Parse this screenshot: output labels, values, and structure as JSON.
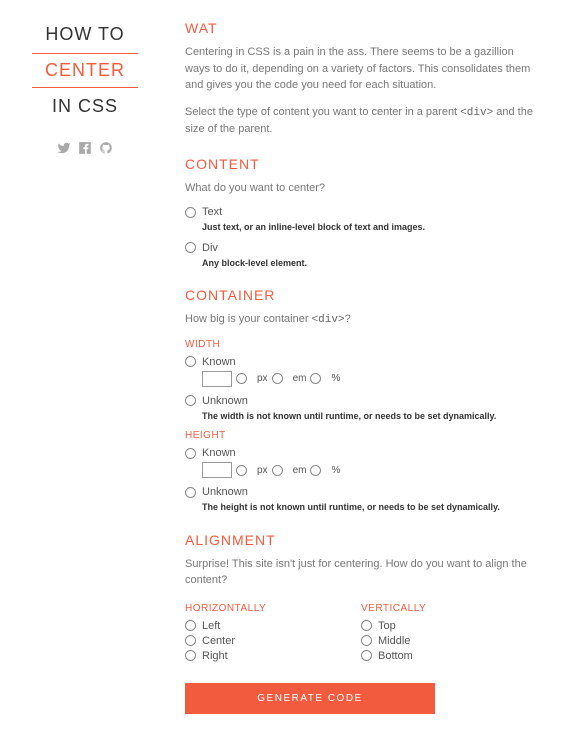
{
  "logo": {
    "line1": "HOW TO",
    "line2": "CENTER",
    "line3": "IN CSS"
  },
  "wat": {
    "heading": "WAT",
    "p1": "Centering in CSS is a pain in the ass. There seems to be a gazillion ways to do it, depending on a variety of factors. This consolidates them and gives you the code you need for each situation.",
    "p2a": "Select the type of content you want to center in a parent ",
    "p2code": "<div>",
    "p2b": " and the size of the parent."
  },
  "content": {
    "heading": "CONTENT",
    "question": "What do you want to center?",
    "opt_text": "Text",
    "opt_text_hint": "Just text, or an inline-level block of text and images.",
    "opt_div": "Div",
    "opt_div_hint": "Any block-level element."
  },
  "container": {
    "heading": "CONTAINER",
    "q_a": "How big is your container ",
    "q_code": "<div>",
    "q_b": "?",
    "width_label": "WIDTH",
    "height_label": "HEIGHT",
    "known": "Known",
    "unknown": "Unknown",
    "px": "px",
    "em": "em",
    "pct": "%",
    "width_unknown_hint": "The width is not known until runtime, or needs to be set dynamically.",
    "height_unknown_hint": "The height is not known until runtime, or needs to be set dynamically."
  },
  "alignment": {
    "heading": "ALIGNMENT",
    "question": "Surprise! This site isn't just for centering. How do you want to align the content?",
    "horiz": "HORIZONTALLY",
    "vert": "VERTICALLY",
    "left": "Left",
    "center": "Center",
    "right": "Right",
    "top": "Top",
    "middle": "Middle",
    "bottom": "Bottom"
  },
  "button": "GENERATE CODE"
}
